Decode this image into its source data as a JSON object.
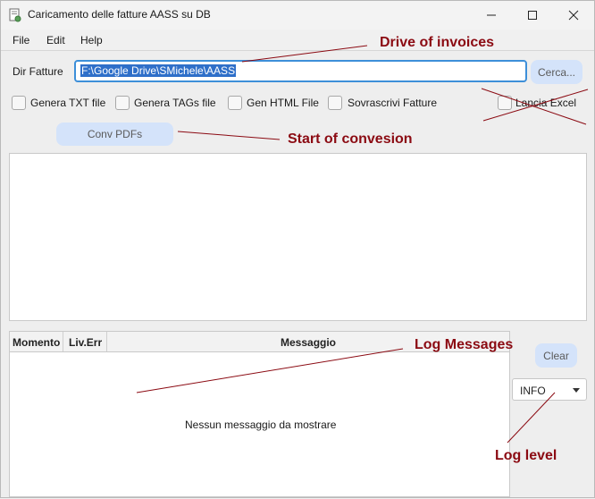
{
  "window": {
    "title": "Caricamento delle fatture AASS su DB"
  },
  "menu": {
    "file": "File",
    "edit": "Edit",
    "help": "Help"
  },
  "form": {
    "dir_label": "Dir Fatture",
    "dir_value": "F:\\Google Drive\\SMichele\\AASS",
    "browse_label": "Cerca..."
  },
  "options": {
    "txt": "Genera TXT file",
    "tags": "Genera TAGs file",
    "html": "Gen HTML File",
    "overwrite": "Sovrascrivi Fatture",
    "excel": "Lancia Excel"
  },
  "actions": {
    "convert_label": "Conv PDFs",
    "clear_label": "Clear"
  },
  "log_table": {
    "columns": [
      "Momento",
      "Liv.Err",
      "Messaggio"
    ],
    "empty_message": "Nessun messaggio da mostrare"
  },
  "log_level": {
    "selected": "INFO"
  },
  "annotations": {
    "drive": "Drive of invoices",
    "start": "Start of convesion",
    "log_messages": "Log Messages",
    "log_level": "Log level"
  },
  "colors": {
    "annotation": "#8b0a12",
    "button_bg": "#d4e3fa",
    "selection": "#2e6fc9",
    "focus_border": "#3d8fd9"
  }
}
